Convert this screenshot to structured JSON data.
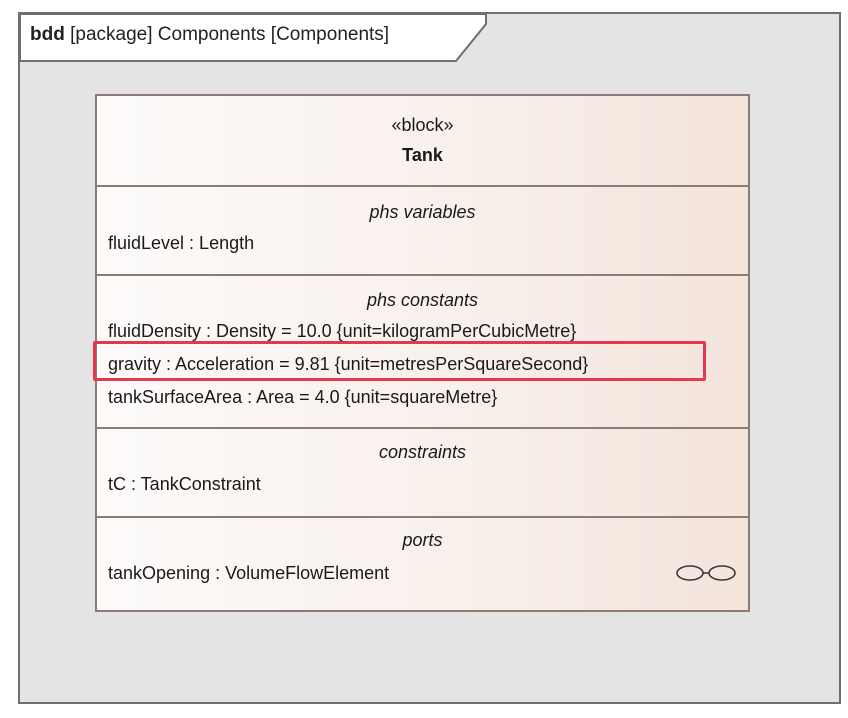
{
  "frame": {
    "kind": "bdd",
    "label": "[package] Components [Components]"
  },
  "block": {
    "stereotype": "«block»",
    "name": "Tank",
    "compartments": {
      "variables": {
        "title": "phs variables",
        "entries": [
          "fluidLevel : Length"
        ]
      },
      "constants": {
        "title": "phs constants",
        "entries": [
          "fluidDensity : Density = 10.0 {unit=kilogramPerCubicMetre}",
          "gravity : Acceleration = 9.81 {unit=metresPerSquareSecond}",
          "tankSurfaceArea : Area = 4.0 {unit=squareMetre}"
        ]
      },
      "constraints": {
        "title": "constraints",
        "entries": [
          "tC : TankConstraint"
        ]
      },
      "ports": {
        "title": "ports",
        "entries": [
          "tankOpening : VolumeFlowElement"
        ]
      }
    }
  },
  "colors": {
    "highlight": "#e5384f",
    "frame_background": "#e4e4e4",
    "block_border": "#8c7b76"
  },
  "icons": {
    "port": "interface-port-icon"
  }
}
